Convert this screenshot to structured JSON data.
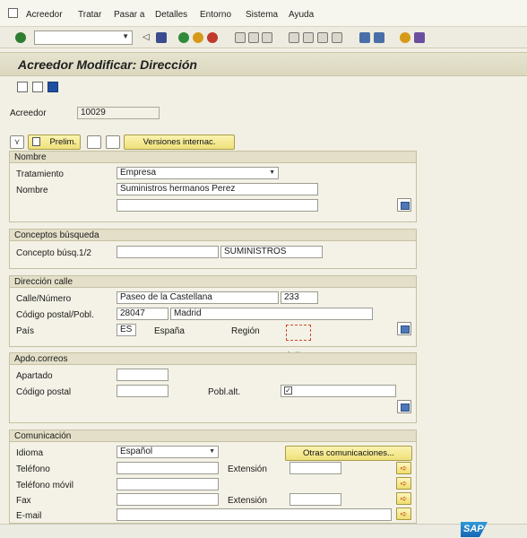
{
  "menu": {
    "items": [
      {
        "label": "Acreedor"
      },
      {
        "label": "Tratar"
      },
      {
        "label": "Pasar a"
      },
      {
        "label": "Detalles"
      },
      {
        "label": "Entorno"
      },
      {
        "label": "Sistema"
      },
      {
        "label": "Ayuda"
      }
    ]
  },
  "title": "Acreedor Modificar: Dirección",
  "acreedor": {
    "label": "Acreedor",
    "value": "10029"
  },
  "actions": {
    "prelim_label": "Prelim.",
    "versiones_label": "Versiones internac."
  },
  "nombre_group": {
    "title": "Nombre",
    "tratamiento_label": "Tratamiento",
    "tratamiento_value": "Empresa",
    "nombre_label": "Nombre",
    "nombre_value": "Suministros hermanos Perez",
    "nombre2_value": ""
  },
  "busqueda_group": {
    "title": "Conceptos búsqueda",
    "concepto_label": "Concepto búsq.1/2",
    "concepto1_value": "",
    "concepto2_value": "SUMINISTROS"
  },
  "direccion_group": {
    "title": "Dirección calle",
    "calle_label": "Calle/Número",
    "calle_value": "Paseo de la Castellana",
    "numero_value": "233",
    "cp_label": "Código postal/Pobl.",
    "cp_value": "28047",
    "poblacion_value": "Madrid",
    "pais_label": "País",
    "pais_value": "ES",
    "pais_text": "España",
    "region_label": "Región",
    "region_value": ""
  },
  "apdo_group": {
    "title": "Apdo.correos",
    "apartado_label": "Apartado",
    "apartado_value": "",
    "cp_label": "Código postal",
    "cp_value": "",
    "poblalt_label": "Pobl.alt.",
    "poblalt_value": ""
  },
  "comunicacion_group": {
    "title": "Comunicación",
    "idioma_label": "Idioma",
    "idioma_value": "Español",
    "otras_label": "Otras comunicaciones...",
    "telefono_label": "Teléfono",
    "telefono_value": "",
    "extension_label": "Extensión",
    "extension_value": "",
    "movil_label": "Teléfono móvil",
    "movil_value": "",
    "fax_label": "Fax",
    "fax_value": "",
    "fax_extension_label": "Extensión",
    "fax_extension_value": "",
    "email_label": "E-mail",
    "email_value": ""
  },
  "brand": {
    "logo_text": "SAP"
  },
  "colors": {
    "accent": "#efe07a",
    "header": "#e3dfc8",
    "background": "#f2f0e4"
  }
}
